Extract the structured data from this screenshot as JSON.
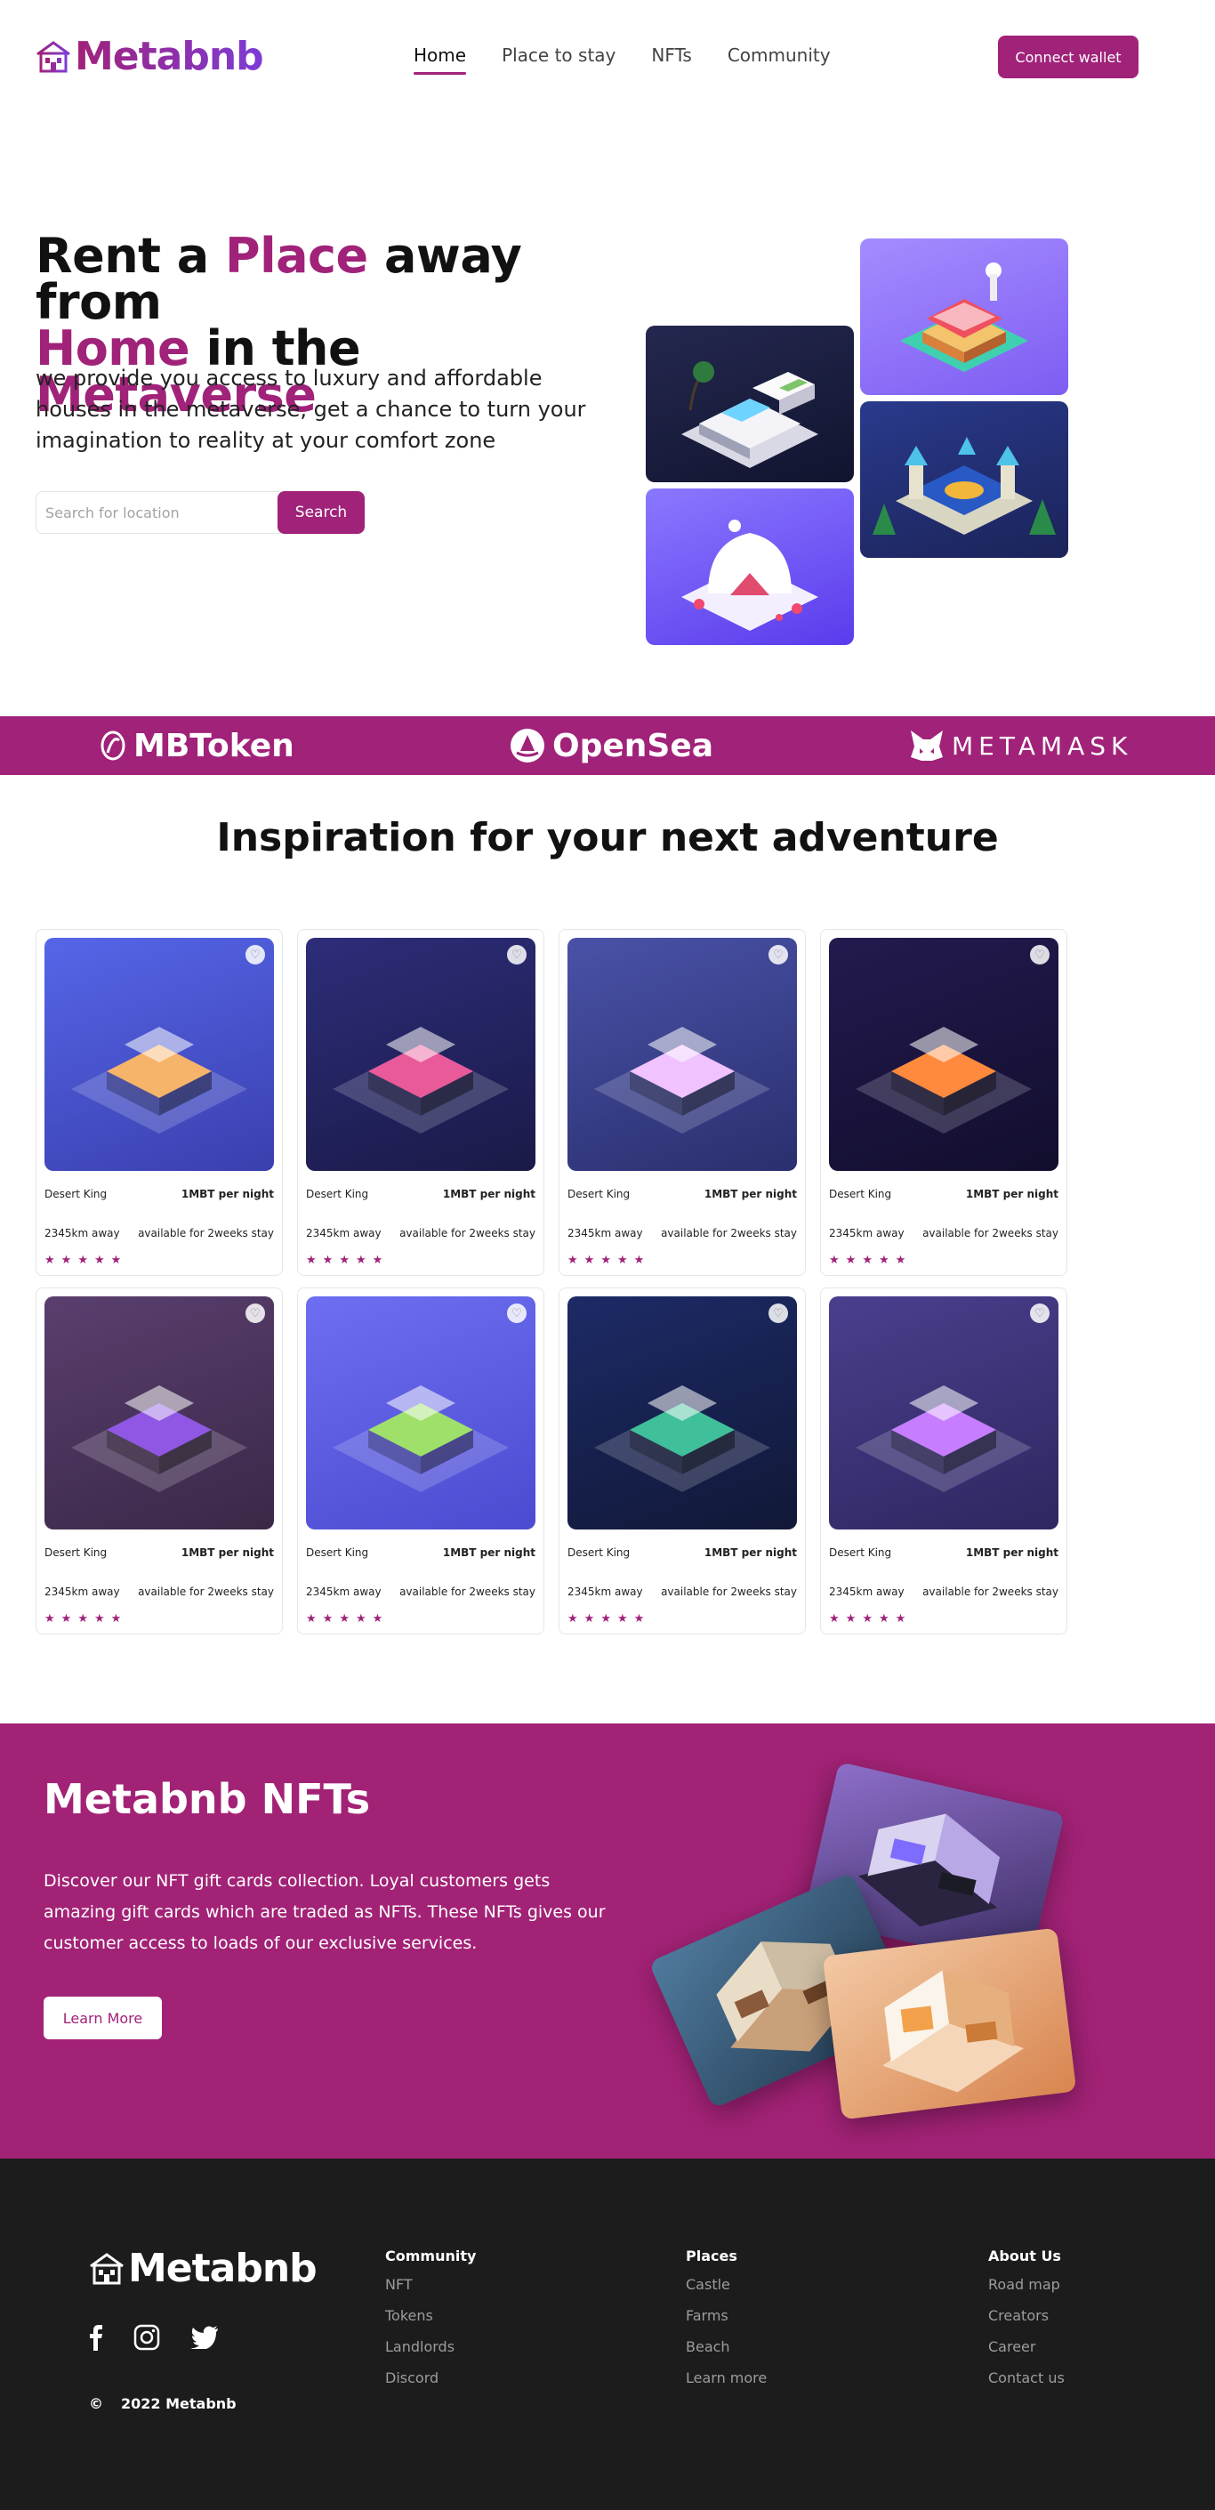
{
  "header": {
    "logo": "Metabnb",
    "nav": [
      {
        "label": "Home",
        "active": true
      },
      {
        "label": "Place to stay",
        "active": false
      },
      {
        "label": "NFTs",
        "active": false
      },
      {
        "label": "Community",
        "active": false
      }
    ],
    "connect_label": "Connect wallet"
  },
  "hero": {
    "title_1": "Rent a ",
    "title_accent_1": "Place",
    "title_2": " away from ",
    "title_accent_2": "Home",
    "title_3": " in the ",
    "title_accent_3": "Metaverse",
    "subtitle": "we provide you access to luxury and affordable houses in the metaverse, get a chance to turn your imagination to reality at your comfort zone",
    "search_placeholder": "Search for location",
    "search_label": "Search"
  },
  "partners": [
    {
      "name": "MBToken",
      "icon": "mbtoken-icon"
    },
    {
      "name": "OpenSea",
      "icon": "opensea-icon"
    },
    {
      "name": "METAMASK",
      "icon": "metamask-fox-icon"
    }
  ],
  "inspiration": {
    "title": "Inspiration for your next adventure",
    "cards": [
      {
        "name": "Desert King",
        "price": "1MBT per night",
        "distance": "2345km away",
        "availability": "available for 2weeks stay",
        "rating": 5
      },
      {
        "name": "Desert King",
        "price": "1MBT per night",
        "distance": "2345km away",
        "availability": "available for 2weeks stay",
        "rating": 5
      },
      {
        "name": "Desert King",
        "price": "1MBT per night",
        "distance": "2345km away",
        "availability": "available for 2weeks stay",
        "rating": 5
      },
      {
        "name": "Desert King",
        "price": "1MBT per night",
        "distance": "2345km away",
        "availability": "available for 2weeks stay",
        "rating": 5
      },
      {
        "name": "Desert King",
        "price": "1MBT per night",
        "distance": "2345km away",
        "availability": "available for 2weeks stay",
        "rating": 5
      },
      {
        "name": "Desert King",
        "price": "1MBT per night",
        "distance": "2345km away",
        "availability": "available for 2weeks stay",
        "rating": 5
      },
      {
        "name": "Desert King",
        "price": "1MBT per night",
        "distance": "2345km away",
        "availability": "available for 2weeks stay",
        "rating": 5
      },
      {
        "name": "Desert King",
        "price": "1MBT per night",
        "distance": "2345km away",
        "availability": "available for 2weeks stay",
        "rating": 5
      }
    ]
  },
  "nft": {
    "title": "Metabnb NFTs",
    "text": "Discover our NFT gift cards collection. Loyal customers gets amazing gift cards which are traded as NFTs. These NFTs gives our customer access to loads of our exclusive services.",
    "learn_label": "Learn More"
  },
  "footer": {
    "logo": "Metabnb",
    "copyright_symbol": "©",
    "copyright": "2022 Metabnb",
    "columns": [
      {
        "title": "Community",
        "links": [
          "NFT",
          "Tokens",
          "Landlords",
          "Discord"
        ]
      },
      {
        "title": "Places",
        "links": [
          "Castle",
          "Farms",
          "Beach",
          "Learn more"
        ]
      },
      {
        "title": "About Us",
        "links": [
          "Road map",
          "Creators",
          "Career",
          "Contact us"
        ]
      }
    ]
  },
  "colors": {
    "brand": "#a02279",
    "nft_bg": "#a22276",
    "footer_bg": "#1c1c1c"
  }
}
